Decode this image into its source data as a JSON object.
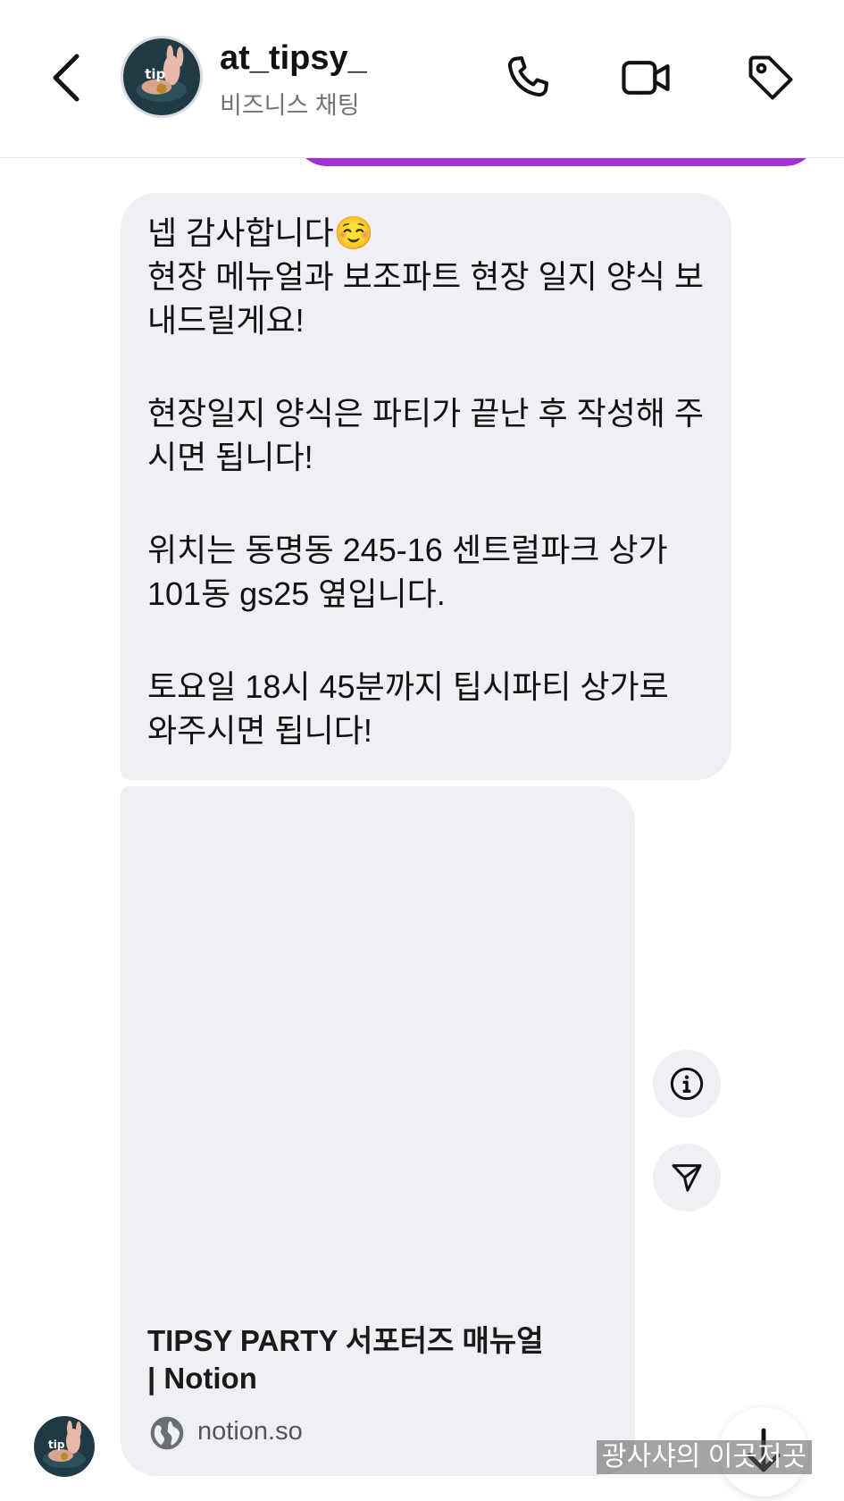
{
  "header": {
    "username": "at_tipsy_",
    "subtitle": "비즈니스 채팅",
    "avatar_text": "tip",
    "icons": {
      "back": "chevron-left-icon",
      "call": "phone-icon",
      "video": "video-camera-icon",
      "label": "tag-icon"
    }
  },
  "message": {
    "paragraphs": [
      "넵 감사합니다☺️\n현장 메뉴얼과 보조파트 현장 일지 양식 보\n내드릴게요!",
      "현장일지 양식은 파티가 끝난 후 작성해 주\n시면 됩니다!",
      "위치는 동명동 245-16 센트럴파크 상가\n101동 gs25 옆입니다.",
      "토요일 18시 45분까지 팁시파티 상가로\n와주시면 됩니다!"
    ]
  },
  "link_preview": {
    "title": "TIPSY PARTY 서포터즈 매뉴얼\n| Notion",
    "domain": "notion.so"
  },
  "side_actions": {
    "info_icon": "info-icon",
    "share_icon": "send-icon"
  },
  "scroll_icon": "arrow-down-icon",
  "watermark": "광사샤의 이곳저곳",
  "colors": {
    "sent_bubble": "#a230d8",
    "received_bubble": "#eef0f4",
    "subtitle_gray": "#737373",
    "background": "#ffffff"
  }
}
